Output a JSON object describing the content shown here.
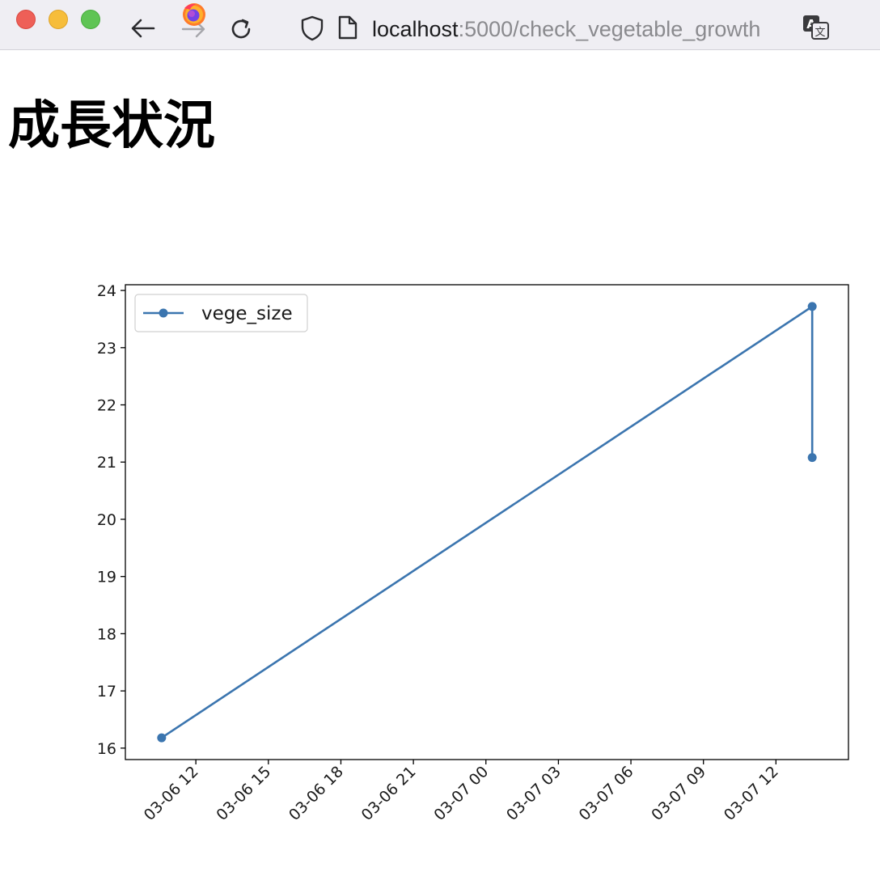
{
  "browser": {
    "url_host": "localhost",
    "url_path": ":5000/check_vegetable_growth",
    "icons": [
      "close-dot",
      "minimize-dot",
      "zoom-dot",
      "back-arrow-icon",
      "firefox-icon",
      "forward-arrow-icon",
      "reload-icon",
      "shield-icon",
      "page-icon",
      "translate-icon"
    ]
  },
  "page": {
    "title": "成長状況"
  },
  "chart_data": {
    "type": "line",
    "marker": "circle",
    "line_color": "#3b75af",
    "series": [
      {
        "name": "vege_size",
        "points": [
          {
            "x": "2023-03-06 10:35",
            "y": 16.18
          },
          {
            "x": "2023-03-07 13:30",
            "y": 23.72
          },
          {
            "x": "2023-03-07 13:30",
            "y": 21.08
          }
        ]
      }
    ],
    "xlim": [
      "2023-03-06 09:05",
      "2023-03-07 15:00"
    ],
    "ylim": [
      15.8,
      24.1
    ],
    "x_ticks": [
      {
        "value": "2023-03-06 12:00",
        "label": "03-06 12"
      },
      {
        "value": "2023-03-06 15:00",
        "label": "03-06 15"
      },
      {
        "value": "2023-03-06 18:00",
        "label": "03-06 18"
      },
      {
        "value": "2023-03-06 21:00",
        "label": "03-06 21"
      },
      {
        "value": "2023-03-07 00:00",
        "label": "03-07 00"
      },
      {
        "value": "2023-03-07 03:00",
        "label": "03-07 03"
      },
      {
        "value": "2023-03-07 06:00",
        "label": "03-07 06"
      },
      {
        "value": "2023-03-07 09:00",
        "label": "03-07 09"
      },
      {
        "value": "2023-03-07 12:00",
        "label": "03-07 12"
      }
    ],
    "y_ticks": [
      16,
      17,
      18,
      19,
      20,
      21,
      22,
      23,
      24
    ],
    "x_tick_rotation_deg": 45,
    "legend": {
      "position": "upper left",
      "entries": [
        "vege_size"
      ]
    },
    "grid": false
  }
}
